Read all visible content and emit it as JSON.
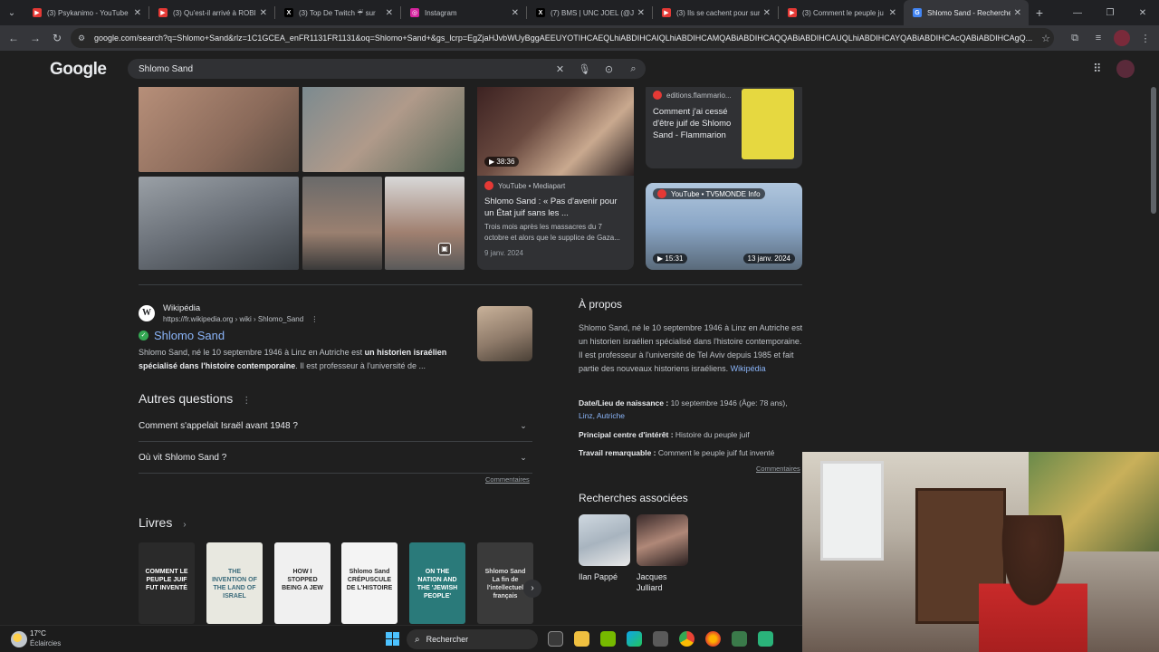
{
  "tabs": [
    {
      "title": "(3) Psykanimo - YouTube",
      "fav_color": "#e53935",
      "fav_glyph": "▶"
    },
    {
      "title": "(3) Qu'est-il arrivé à ROBI",
      "fav_color": "#e53935",
      "fav_glyph": "▶"
    },
    {
      "title": "(3) Top De Twitch ☔ sur",
      "fav_color": "#000000",
      "fav_glyph": "X"
    },
    {
      "title": "Instagram",
      "fav_color": "#d6249f",
      "fav_glyph": "◎"
    },
    {
      "title": "(7) BMS | UNC JOEL (@Jo",
      "fav_color": "#000000",
      "fav_glyph": "X"
    },
    {
      "title": "(3) Ils se cachent pour sur",
      "fav_color": "#e53935",
      "fav_glyph": "▶"
    },
    {
      "title": "(3) Comment le peuple ju",
      "fav_color": "#e53935",
      "fav_glyph": "▶"
    },
    {
      "title": "Shlomo Sand - Recherche",
      "fav_color": "#4285f4",
      "fav_glyph": "G",
      "active": true
    }
  ],
  "omnibox": {
    "url": "google.com/search?q=Shlomo+Sand&rlz=1C1GCEA_enFR1131FR1131&oq=Shlomo+Sand+&gs_lcrp=EgZjaHJvbWUyBggAEEUYOTIHCAEQLhiABDIHCAIQLhiABDIHCAMQABiABDIHCAQQABiABDIHCAUQLhiABDIHCAYQABiABDIHCAcQABiABDIHCAgQ..."
  },
  "google": {
    "logo": "Google",
    "query": "Shlomo Sand"
  },
  "images": {
    "video1": {
      "duration": "38:36",
      "source": "YouTube • Mediapart",
      "title": "Shlomo Sand : « Pas d'avenir pour un État juif sans les ...",
      "snippet": "Trois mois après les massacres du 7 octobre et alors que le supplice de Gaza...",
      "date": "9 janv. 2024"
    },
    "book_card": {
      "source": "editions.flammario...",
      "title": "Comment j'ai cessé d'être juif de Shlomo Sand - Flammarion"
    },
    "video2": {
      "source": "YouTube • TV5MONDE Info",
      "duration": "15:31",
      "date": "13 janv. 2024"
    }
  },
  "wiki": {
    "icon": "W",
    "name": "Wikipédia",
    "url": "https://fr.wikipedia.org › wiki › Shlomo_Sand",
    "title": "Shlomo Sand",
    "snippet_a": "Shlomo Sand, né le 10 septembre 1946 à Linz en Autriche est ",
    "snippet_b": "un historien israélien spécialisé dans l'histoire contemporaine",
    "snippet_c": ". Il est professeur à l'université de ..."
  },
  "paa": {
    "heading": "Autres questions",
    "items": [
      "Comment s'appelait Israël avant 1948 ?",
      "Où vit Shlomo Sand ?"
    ],
    "comments": "Commentaires"
  },
  "books": {
    "heading": "Livres",
    "items": [
      {
        "text": "COMMENT LE PEUPLE JUIF FUT INVENTÉ",
        "bg": "#2a2a2a",
        "fg": "#ffffff"
      },
      {
        "text": "THE INVENTION OF THE LAND OF ISRAEL",
        "bg": "#e8e8e0",
        "fg": "#3a6a7a"
      },
      {
        "text": "HOW I STOPPED BEING A JEW",
        "bg": "#f0f0f0",
        "fg": "#2a2a2a"
      },
      {
        "text": "Shlomo Sand CRÉPUSCULE DE L'HISTOIRE",
        "bg": "#f4f4f4",
        "fg": "#2a2a2a"
      },
      {
        "text": "ON THE NATION AND THE 'JEWISH PEOPLE'",
        "bg": "#2a7a7a",
        "fg": "#ffffff"
      },
      {
        "text": "Shlomo Sand La fin de l'intellectuel français",
        "bg": "#3a3a3a",
        "fg": "#e0e0e0"
      }
    ]
  },
  "kp": {
    "heading": "À propos",
    "desc": "Shlomo Sand, né le 10 septembre 1946 à Linz en Autriche est un historien israélien spécialisé dans l'histoire contemporaine. Il est professeur à l'université de Tel Aviv depuis 1985 et fait partie des nouveaux historiens israéliens. ",
    "desc_link": "Wikipédia",
    "birth_label": "Date/Lieu de naissance :",
    "birth_value": " 10 septembre 1946 (Âge: 78 ans), ",
    "birth_link": "Linz, Autriche",
    "interest_label": "Principal centre d'intérêt :",
    "interest_value": " Histoire du peuple juif",
    "work_label": "Travail remarquable :",
    "work_value": " Comment le peuple juif fut inventé",
    "comments": "Commentaires",
    "related_heading": "Recherches associées",
    "related": [
      {
        "name": "Ilan Pappé"
      },
      {
        "name": "Jacques Julliard"
      }
    ]
  },
  "taskbar": {
    "temp": "17°C",
    "weather": "Éclaircies",
    "search": "Rechercher"
  }
}
